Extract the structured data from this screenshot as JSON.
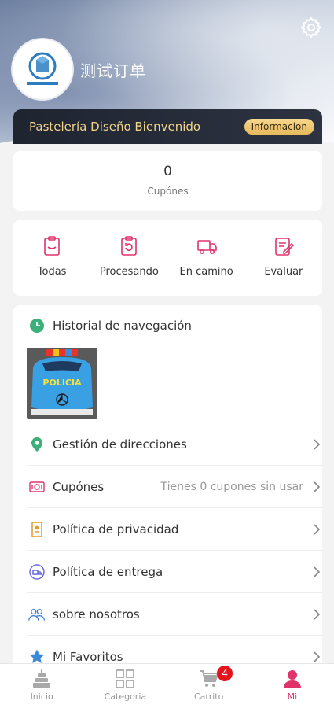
{
  "profile": {
    "username": "测试订单",
    "logo_icon": "company-logo-icon"
  },
  "banner": {
    "title": "Pastelería Diseño Bienvenido",
    "button_label": "Informacion"
  },
  "coupons": {
    "count": "0",
    "label": "Cupónes"
  },
  "orders": [
    {
      "label": "Todas",
      "icon": "clipboard-icon"
    },
    {
      "label": "Procesando",
      "icon": "refresh-clipboard-icon"
    },
    {
      "label": "En camino",
      "icon": "truck-icon"
    },
    {
      "label": "Evaluar",
      "icon": "edit-note-icon"
    }
  ],
  "history": {
    "title": "Historial de navegación",
    "thumb_text": "POLICIA"
  },
  "menu": [
    {
      "label": "Gestión de direcciones",
      "value": "",
      "icon": "location-pin-icon"
    },
    {
      "label": "Cupónes",
      "value": "Tienes 0 cupones sin usar",
      "icon": "ticket-icon"
    },
    {
      "label": "Política de privacidad",
      "value": "",
      "icon": "document-icon"
    },
    {
      "label": "Política de entrega",
      "value": "",
      "icon": "delivery-icon"
    },
    {
      "label": "sobre nosotros",
      "value": "",
      "icon": "people-icon"
    },
    {
      "label": "Mi Favoritos",
      "value": "",
      "icon": "star-icon"
    }
  ],
  "tabs": [
    {
      "label": "Inicio",
      "icon": "cake-icon"
    },
    {
      "label": "Categoria",
      "icon": "grid-icon"
    },
    {
      "label": "Carrito",
      "icon": "cart-icon",
      "badge": "4"
    },
    {
      "label": "Mi",
      "icon": "user-icon",
      "active": true
    }
  ],
  "colors": {
    "accent": "#e0336a",
    "banner_gold": "#f2d48a",
    "badge_red": "#e4141e"
  }
}
